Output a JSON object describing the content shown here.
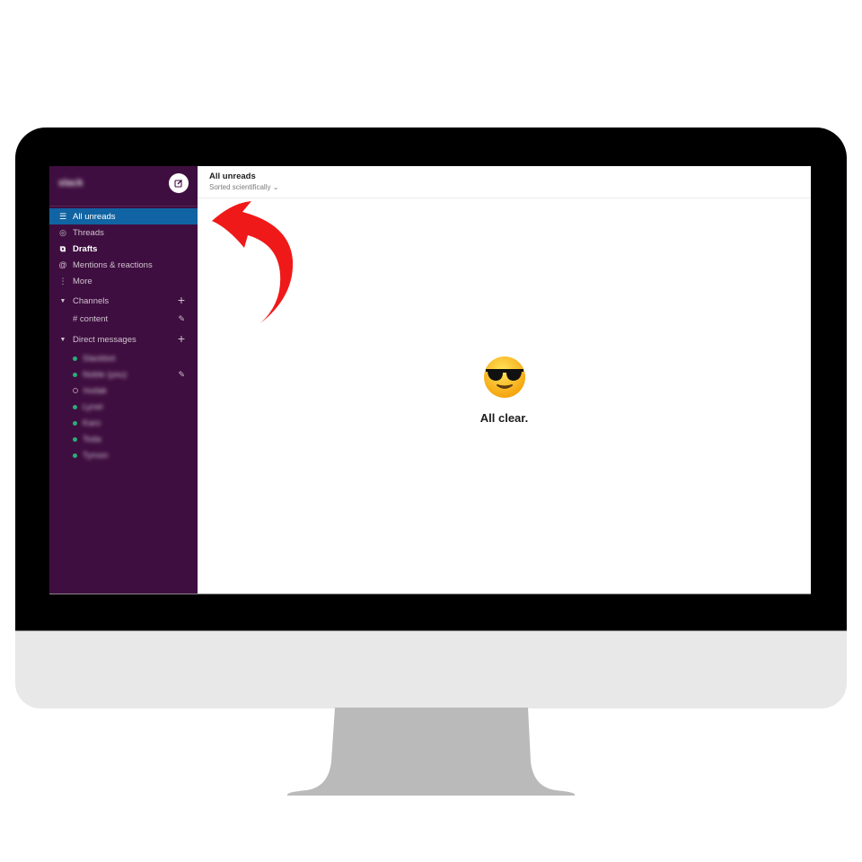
{
  "monitor": {
    "bezel_color": "#000000",
    "chin_color": "#e8e8e8",
    "stand_color": "#bababa"
  },
  "sidebar": {
    "workspace_name": "slack",
    "compose_icon": "compose-icon",
    "nav": [
      {
        "label": "All unreads",
        "icon": "all-unreads-icon",
        "active": true
      },
      {
        "label": "Threads",
        "icon": "threads-icon"
      },
      {
        "label": "Drafts",
        "icon": "drafts-icon",
        "bold": true
      },
      {
        "label": "Mentions & reactions",
        "icon": "at-icon"
      },
      {
        "label": "More",
        "icon": "more-icon"
      }
    ],
    "channels_label": "Channels",
    "channels": [
      {
        "name": "# content"
      }
    ],
    "dm_label": "Direct messages",
    "direct_messages": [
      {
        "name": "Slackbot",
        "status": "online"
      },
      {
        "name": "Noble (you)",
        "status": "online"
      },
      {
        "name": "hodak",
        "status": "away"
      },
      {
        "name": "Lynel",
        "status": "online"
      },
      {
        "name": "Karo",
        "status": "online"
      },
      {
        "name": "Toda",
        "status": "online"
      },
      {
        "name": "Tymon",
        "status": "online"
      }
    ],
    "colors": {
      "background": "#3f0e40",
      "active": "#1164a3",
      "presence": "#2bac76"
    }
  },
  "main": {
    "title": "All unreads",
    "subtitle": "Sorted scientifically",
    "subtitle_caret": "⌄",
    "empty_emoji": "😎",
    "empty_text": "All clear."
  },
  "annotation": {
    "type": "curved-arrow",
    "color": "#f01919",
    "points_to": "All unreads"
  }
}
